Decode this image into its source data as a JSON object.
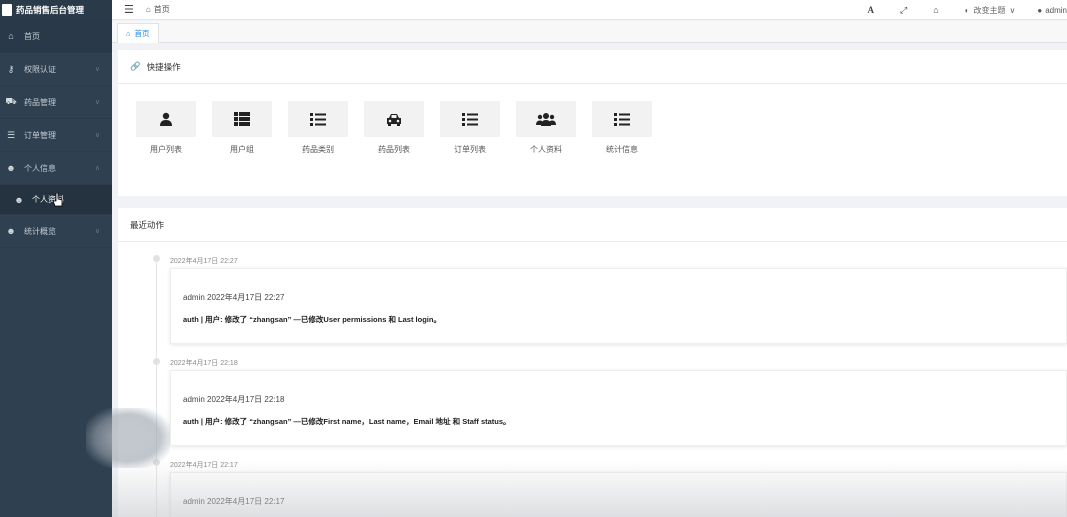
{
  "app": {
    "title": "药品销售后台管理"
  },
  "sidebar": {
    "items": [
      {
        "icon": "home-icon",
        "glyph": "⌂",
        "label": "首页",
        "has_arrow": false
      },
      {
        "icon": "user-key-icon",
        "glyph": "👤",
        "label": "权限认证",
        "has_arrow": true
      },
      {
        "icon": "car-icon",
        "glyph": "🚗",
        "label": "药品管理",
        "has_arrow": true
      },
      {
        "icon": "list-icon",
        "glyph": "☰",
        "label": "订单管理",
        "has_arrow": true
      },
      {
        "icon": "users-icon",
        "glyph": "👥",
        "label": "个人信息",
        "has_arrow": true,
        "expanded": true
      },
      {
        "icon": "users-icon",
        "glyph": "👥",
        "label": "个人资料",
        "sub": true
      },
      {
        "icon": "users-icon",
        "glyph": "👥",
        "label": "统计概览",
        "has_arrow": true
      }
    ]
  },
  "topbar": {
    "menu_icon": "☰",
    "breadcrumb": "首页",
    "font_icon_label": "A",
    "theme_label": "改变主题",
    "user_label": "admin"
  },
  "tabs": {
    "active": "首页"
  },
  "quick": {
    "title": "快捷操作",
    "items": [
      {
        "label": "用户列表",
        "icon": "user-icon",
        "glyph": "👤"
      },
      {
        "label": "用户组",
        "icon": "th-list-icon",
        "glyph": "▦"
      },
      {
        "label": "药品类别",
        "icon": "list-icon",
        "glyph": "☰"
      },
      {
        "label": "药品列表",
        "icon": "car-icon",
        "glyph": "🚘"
      },
      {
        "label": "订单列表",
        "icon": "list-icon",
        "glyph": "☰"
      },
      {
        "label": "个人资料",
        "icon": "users-icon",
        "glyph": "👥"
      },
      {
        "label": "统计信息",
        "icon": "list-icon",
        "glyph": "☰"
      }
    ]
  },
  "recent": {
    "title": "最近动作",
    "entries": [
      {
        "date": "2022年4月17日 22:27",
        "who": "admin 2022年4月17日 22:27",
        "what": "auth | 用户: 修改了 “zhangsan” —已修改User permissions 和 Last login。"
      },
      {
        "date": "2022年4月17日 22:18",
        "who": "admin 2022年4月17日 22:18",
        "what": "auth | 用户: 修改了 “zhangsan” —已修改First name，Last name，Email 地址 和 Staff status。"
      },
      {
        "date": "2022年4月17日 22:17",
        "who": "admin 2022年4月17日 22:17",
        "what": ""
      }
    ]
  },
  "colors": {
    "sidebar": "#2f4050",
    "accent": "#1e88e5"
  }
}
